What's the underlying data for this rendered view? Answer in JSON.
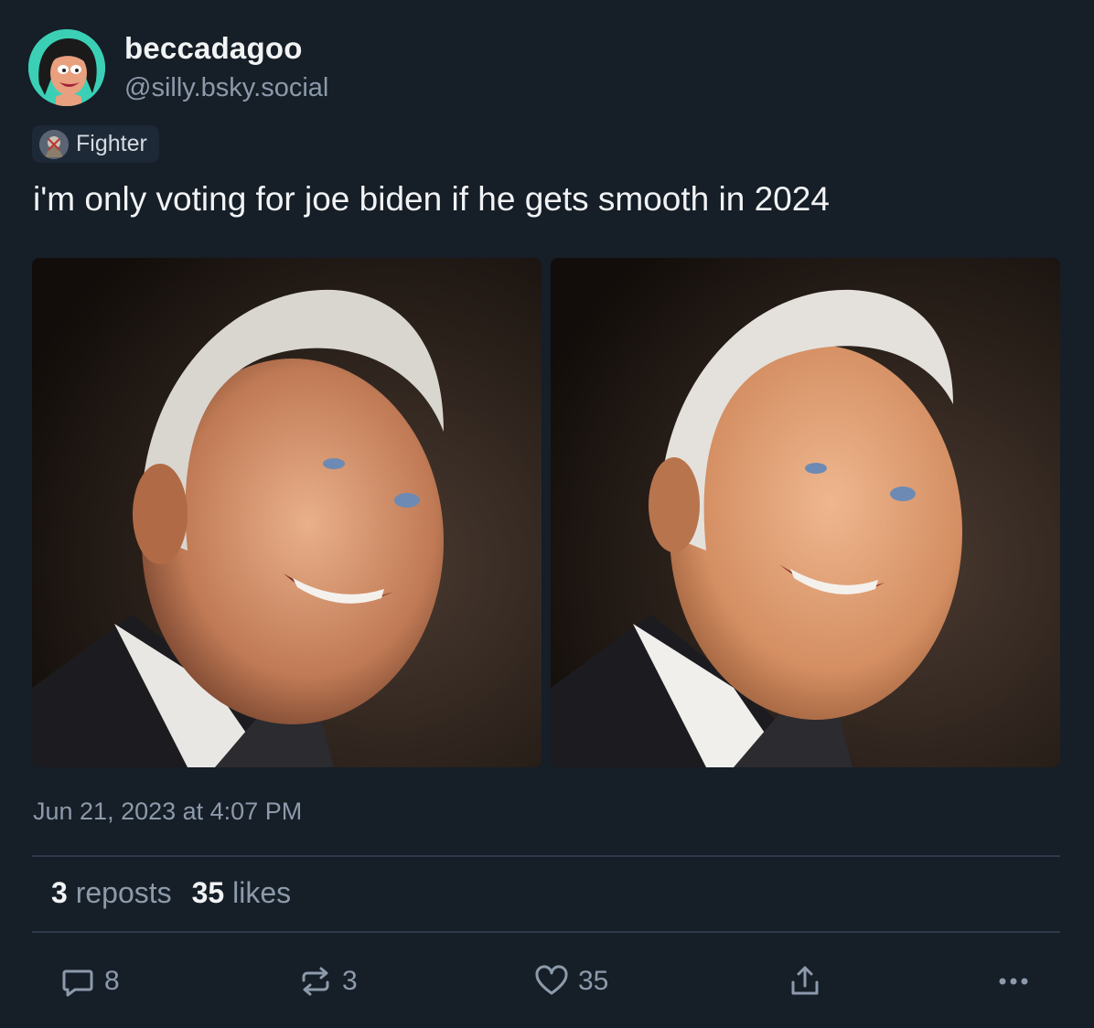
{
  "author": {
    "display_name": "beccadagoo",
    "handle": "@silly.bsky.social",
    "avatar_icon": "cartoon-woman-avatar"
  },
  "label": {
    "text": "Fighter",
    "icon": "fighter-badge-icon"
  },
  "post": {
    "text": "i'm only voting for joe biden if he gets smooth in 2024",
    "images": [
      {
        "name": "original-photo"
      },
      {
        "name": "smoothed-photo"
      }
    ],
    "timestamp": "Jun 21, 2023 at 4:07 PM"
  },
  "stats": {
    "reposts_count": "3",
    "reposts_label": "reposts",
    "likes_count": "35",
    "likes_label": "likes"
  },
  "actions": {
    "reply_count": "8",
    "repost_count": "3",
    "like_count": "35"
  },
  "colors": {
    "background": "#161e27",
    "primary_text": "#f1f3f5",
    "secondary_text": "#8c9aab",
    "divider": "#2e3a4a",
    "avatar_bg": "#3bd0b5"
  }
}
